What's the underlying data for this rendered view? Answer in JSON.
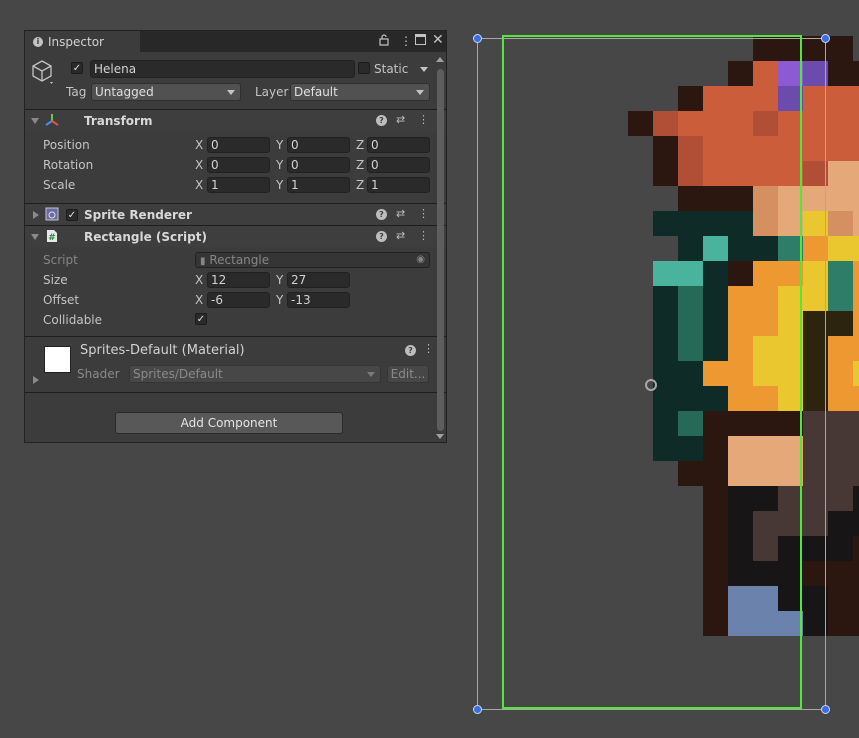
{
  "inspector": {
    "tab_label": "Inspector",
    "gameobject": {
      "name": "Helena",
      "active": true,
      "static_label": "Static",
      "static": false
    },
    "tag_label": "Tag",
    "tag_value": "Untagged",
    "layer_label": "Layer",
    "layer_value": "Default",
    "transform": {
      "title": "Transform",
      "position_label": "Position",
      "rotation_label": "Rotation",
      "scale_label": "Scale",
      "position": {
        "x": "0",
        "y": "0",
        "z": "0"
      },
      "rotation": {
        "x": "0",
        "y": "0",
        "z": "0"
      },
      "scale": {
        "x": "1",
        "y": "1",
        "z": "1"
      }
    },
    "sprite_renderer": {
      "title": "Sprite Renderer",
      "enabled": true
    },
    "rectangle_script": {
      "title": "Rectangle (Script)",
      "script_label": "Script",
      "script_value": "Rectangle",
      "size_label": "Size",
      "size": {
        "x": "12",
        "y": "27"
      },
      "offset_label": "Offset",
      "offset": {
        "x": "-6",
        "y": "-13"
      },
      "collidable_label": "Collidable",
      "collidable": true
    },
    "material": {
      "title": "Sprites-Default (Material)",
      "shader_label": "Shader",
      "shader_value": "Sprites/Default",
      "edit_label": "Edit..."
    },
    "add_component_label": "Add Component",
    "axis_labels": {
      "x": "X",
      "y": "Y",
      "z": "Z"
    }
  },
  "icons": [
    "info-icon",
    "lock-icon",
    "kebab-menu-icon",
    "maximize-icon",
    "close-icon",
    "gameobject-cube-icon",
    "transform-icon",
    "sprite-renderer-icon",
    "script-icon",
    "help-icon",
    "preset-icon",
    "material-preview"
  ],
  "colors": {
    "bounds_green": "#52e83a",
    "handle_blue": "#3a6fe0",
    "sprite_palette": {
      "D": "#2c1710",
      "R": "#cc5d3b",
      "r": "#b14f36",
      "P": "#8c5bd3",
      "p": "#6b4cad",
      "S": "#e5a878",
      "s": "#d49061",
      "Y": "#eac62f",
      "O": "#ee9832",
      "B": "#2c240e",
      "T": "#0f2b27",
      "t": "#4ab39d",
      "G": "#2e7d69",
      "g": "#266956",
      "N": "#483835",
      "n": "#3d2f2c",
      "K": "#181516",
      "L": "#6a82ac",
      "E": "#616161"
    }
  }
}
